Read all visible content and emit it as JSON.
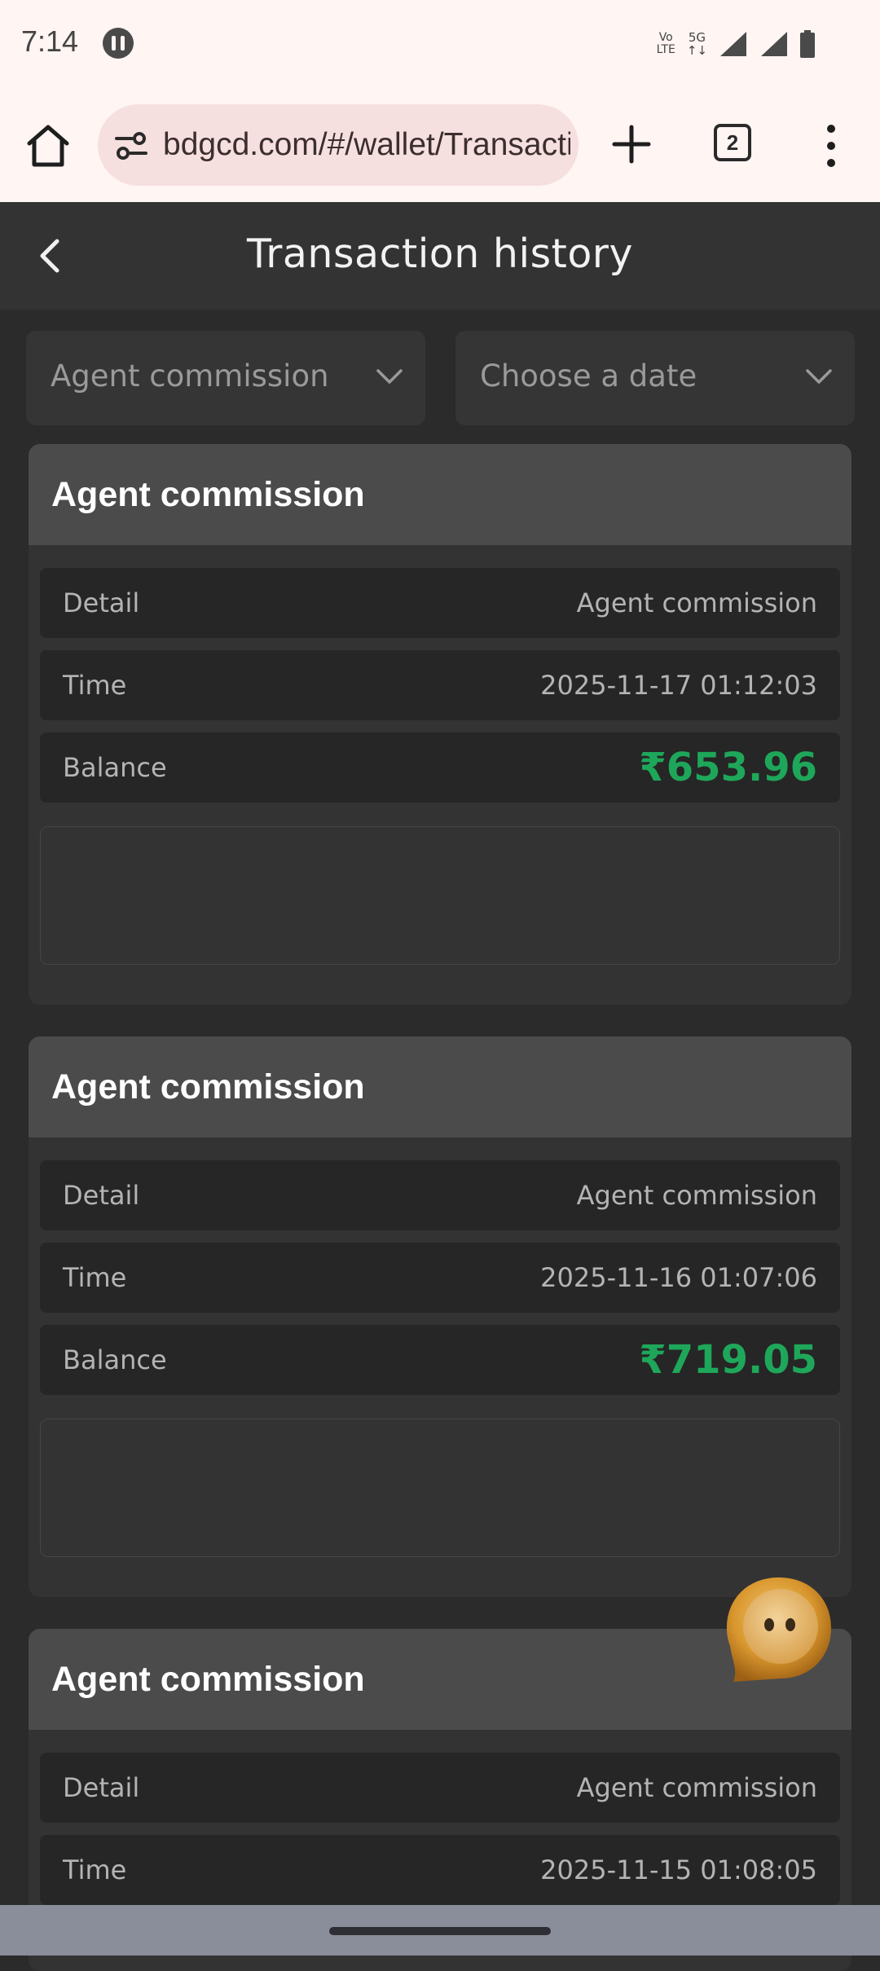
{
  "status_bar": {
    "time": "7:14",
    "volte_top": "Vo",
    "volte_bottom": "LTE",
    "network_top": "5G",
    "network_bottom": "↑↓",
    "app_icon": "pause-dots-icon",
    "signal_icons": [
      "signal-icon",
      "signal-icon"
    ],
    "battery_icon": "battery-icon"
  },
  "browser": {
    "home_icon": "home-icon",
    "site_settings_icon": "tune-icon",
    "url": "bdgcd.com/#/wallet/TransactionHistory",
    "new_tab_icon": "plus-icon",
    "tab_count": "2",
    "menu_icon": "more-vert-icon"
  },
  "header": {
    "back_icon": "chevron-left-icon",
    "title": "Transaction history"
  },
  "filters": {
    "type_label": "Agent commission",
    "date_label": "Choose a date",
    "dropdown_icon": "chevron-down-icon"
  },
  "transactions": [
    {
      "title": "Agent commission",
      "detail_label": "Detail",
      "detail_value": "Agent commission",
      "time_label": "Time",
      "time_value": "2025-11-17 01:12:03",
      "balance_label": "Balance",
      "balance_value": "₹653.96"
    },
    {
      "title": "Agent commission",
      "detail_label": "Detail",
      "detail_value": "Agent commission",
      "time_label": "Time",
      "time_value": "2025-11-16 01:07:06",
      "balance_label": "Balance",
      "balance_value": "₹719.05"
    },
    {
      "title": "Agent commission",
      "detail_label": "Detail",
      "detail_value": "Agent commission",
      "time_label": "Time",
      "time_value": "2025-11-15 01:08:05"
    }
  ],
  "colors": {
    "balance_green": "#1ea75a",
    "card_header": "#4b4b4b",
    "page_bg": "#2b2b2b"
  },
  "chat_fab_icon": "chat-bubble-icon"
}
